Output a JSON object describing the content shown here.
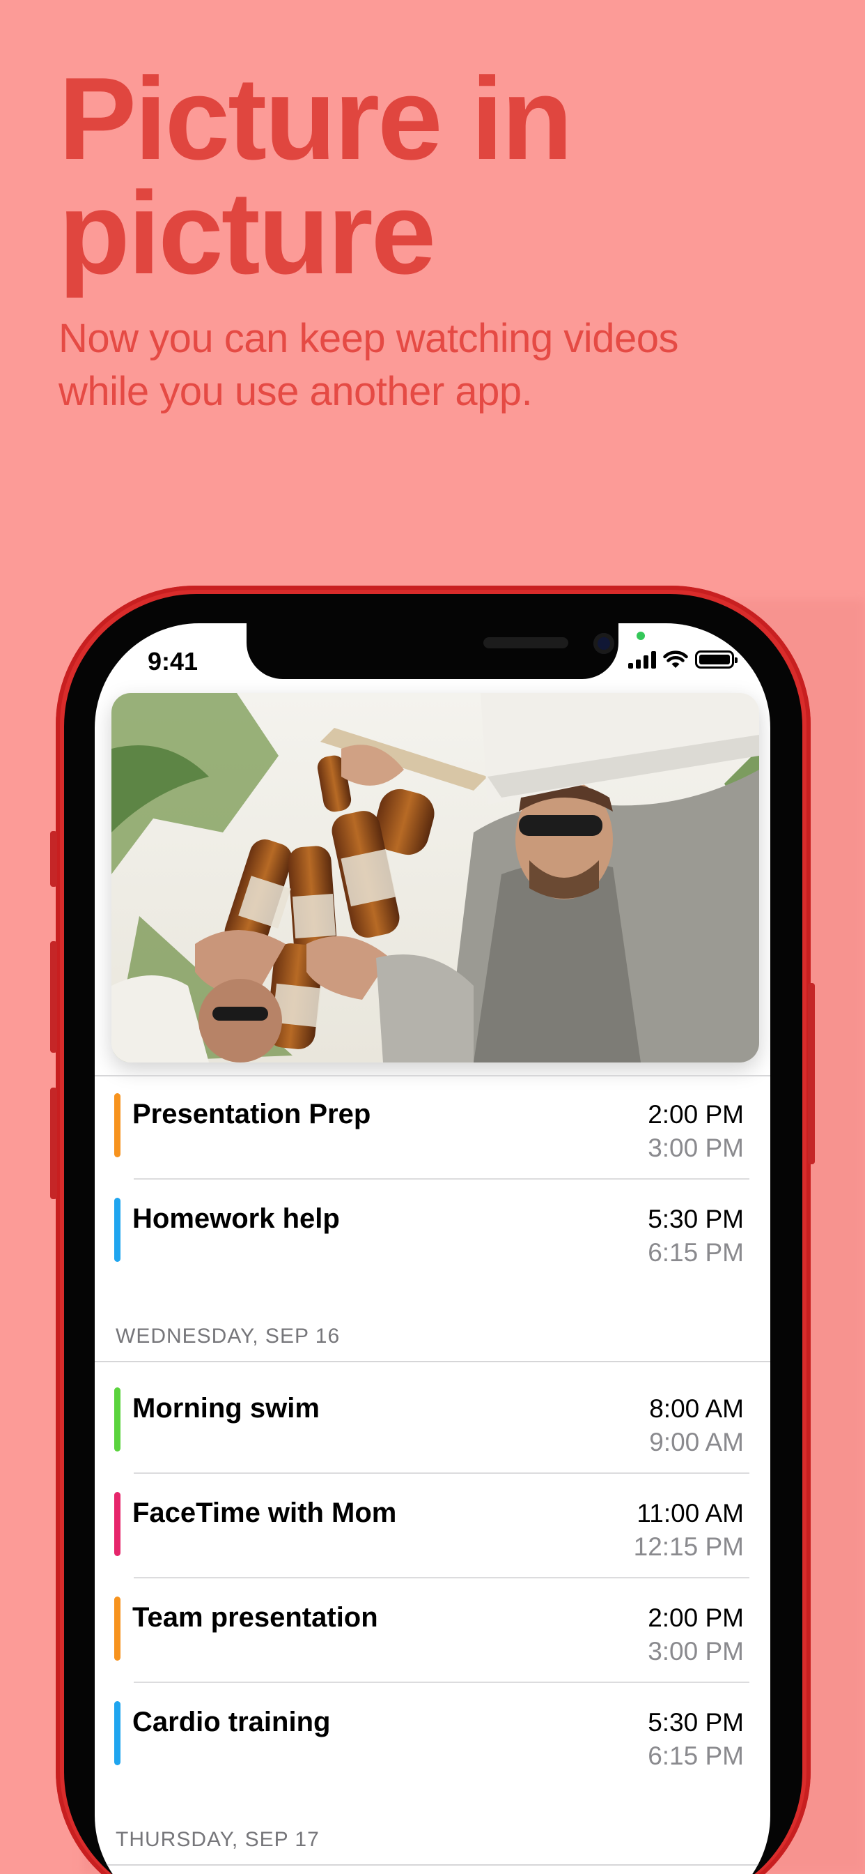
{
  "promo": {
    "headline_line1": "Picture in",
    "headline_line2": "picture",
    "subhead_line1": "Now you can keep watching videos",
    "subhead_line2": "while you use another app."
  },
  "status_bar": {
    "time": "9:41"
  },
  "video": {
    "icon": "video-frame"
  },
  "calendar": {
    "groups": [
      {
        "header": "",
        "events": [
          {
            "title": "Presentation Prep",
            "start": "2:00 PM",
            "end": "3:00 PM",
            "color": "#f7931e"
          },
          {
            "title": "Homework help",
            "start": "5:30 PM",
            "end": "6:15 PM",
            "color": "#1fa5ef"
          }
        ]
      },
      {
        "header": "WEDNESDAY, SEP 16",
        "events": [
          {
            "title": "Morning swim",
            "start": "8:00 AM",
            "end": "9:00 AM",
            "color": "#5ad33d"
          },
          {
            "title": "FaceTime with Mom",
            "start": "11:00 AM",
            "end": "12:15 PM",
            "color": "#e6266b"
          },
          {
            "title": "Team presentation",
            "start": "2:00 PM",
            "end": "3:00 PM",
            "color": "#f7931e"
          },
          {
            "title": "Cardio training",
            "start": "5:30 PM",
            "end": "6:15 PM",
            "color": "#1fa5ef"
          }
        ]
      },
      {
        "header": "THURSDAY, SEP 17",
        "events": []
      }
    ]
  },
  "colors": {
    "background": "#fc9b97",
    "headline": "#e0463f",
    "phone": "#d92c2b"
  }
}
